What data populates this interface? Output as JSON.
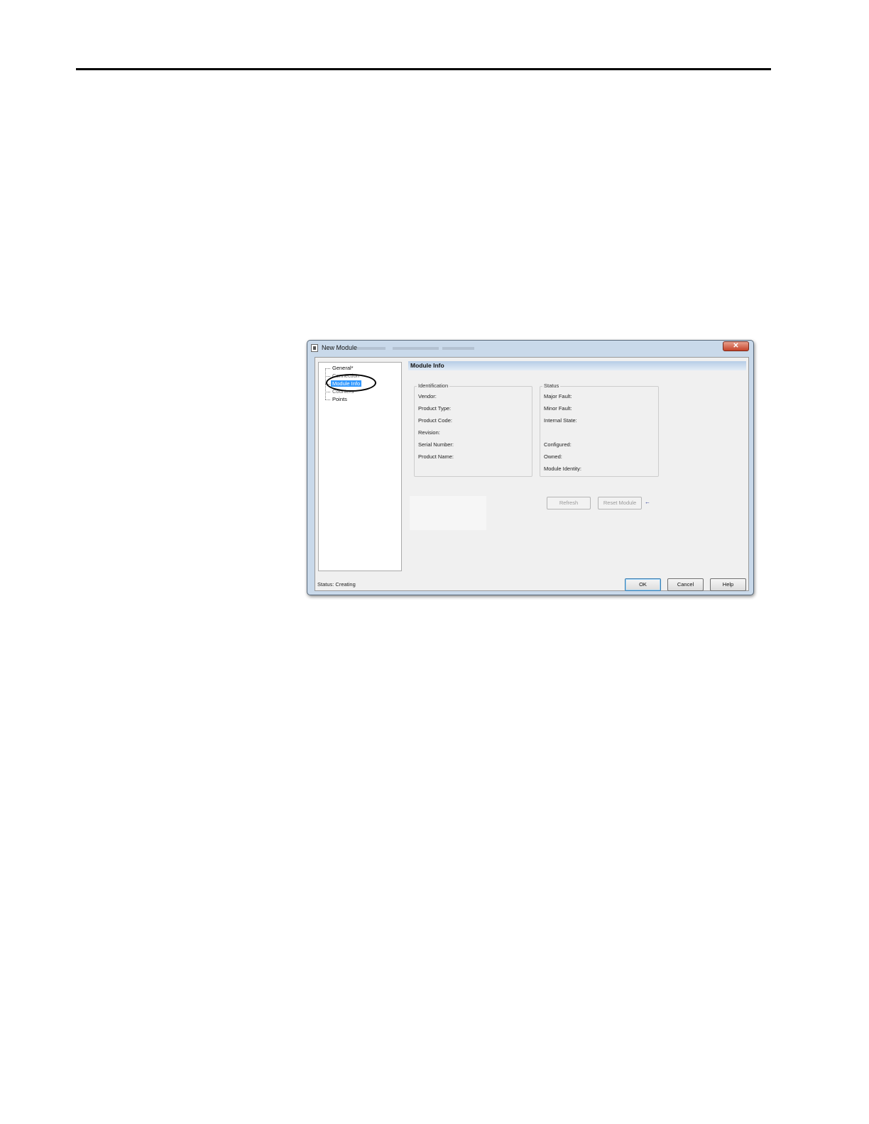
{
  "dialog": {
    "title": "New Module",
    "close_symbol": "✕"
  },
  "tree": {
    "items": [
      {
        "label": "General*"
      },
      {
        "label": "Connection"
      },
      {
        "label": "Module Info"
      },
      {
        "label": "Counters"
      },
      {
        "label": "Points"
      }
    ]
  },
  "section": {
    "header": "Module Info"
  },
  "identification": {
    "legend": "Identification",
    "fields": [
      "Vendor:",
      "Product Type:",
      "Product Code:",
      "Revision:",
      "Serial Number:",
      "Product Name:"
    ]
  },
  "status_group": {
    "legend": "Status",
    "fields": [
      "Major Fault:",
      "Minor Fault:",
      "Internal State:",
      "Configured:",
      "Owned:",
      "Module Identity:"
    ]
  },
  "buttons": {
    "refresh": "Refresh",
    "reset_module": "Reset Module",
    "ok": "OK",
    "cancel": "Cancel",
    "help": "Help",
    "arrow_symbol": "←"
  },
  "status_bar": {
    "text": "Status:  Creating"
  },
  "icons": {
    "window": "window-icon",
    "close": "close-icon",
    "reset_arrow": "arrow-left-icon"
  }
}
